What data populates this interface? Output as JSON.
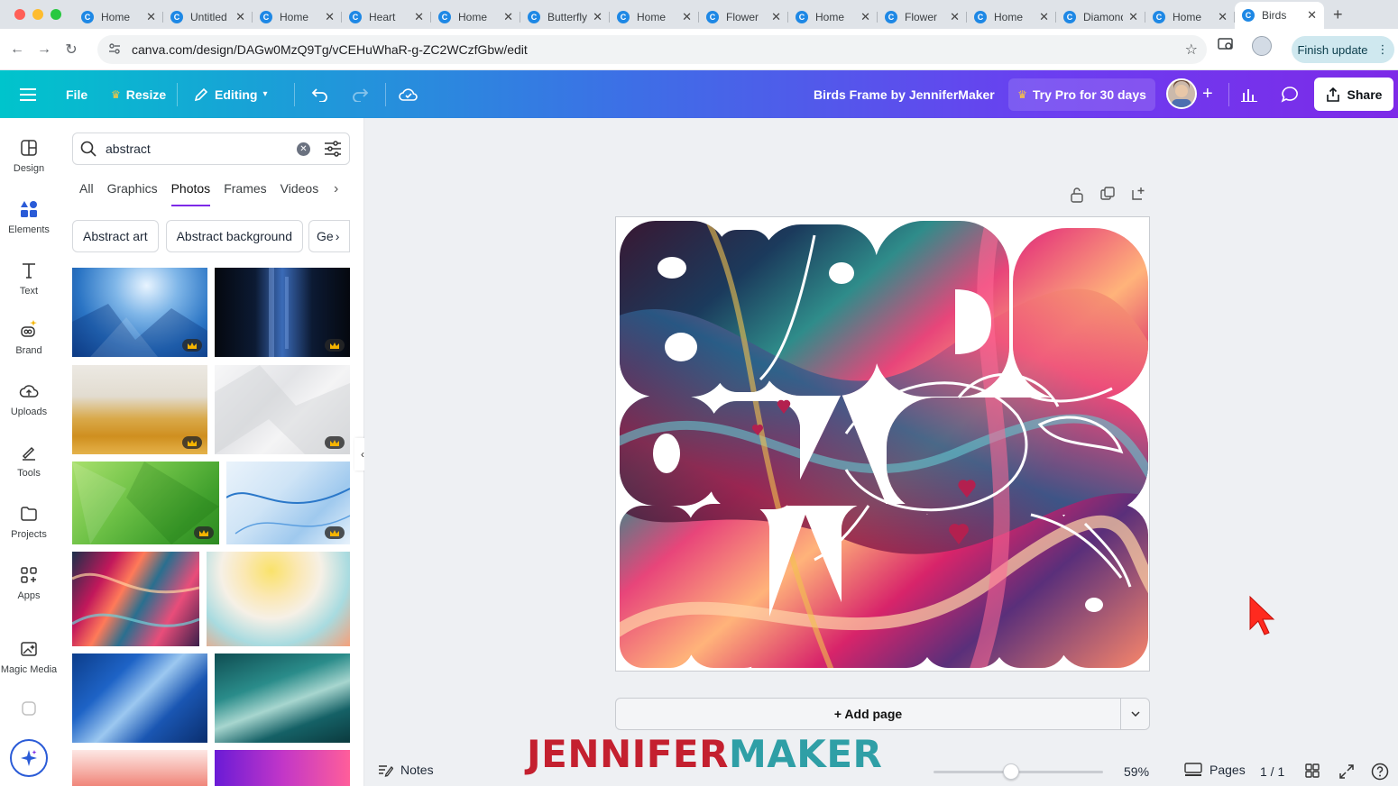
{
  "browser": {
    "tabs": [
      {
        "label": "Home"
      },
      {
        "label": "Untitled"
      },
      {
        "label": "Home"
      },
      {
        "label": "Heart"
      },
      {
        "label": "Home"
      },
      {
        "label": "Butterfly"
      },
      {
        "label": "Home"
      },
      {
        "label": "Flower"
      },
      {
        "label": "Home"
      },
      {
        "label": "Flower"
      },
      {
        "label": "Home"
      },
      {
        "label": "Diamond"
      },
      {
        "label": "Home"
      },
      {
        "label": "Birds",
        "active": true
      }
    ],
    "url": "canva.com/design/DAGw0MzQ9Tg/vCEHuWhaR-g-ZC2WCzfGbw/edit",
    "finish_update": "Finish update"
  },
  "header": {
    "file": "File",
    "resize": "Resize",
    "editing": "Editing",
    "doc_title": "Birds Frame by JenniferMaker",
    "try_pro": "Try Pro for 30 days",
    "share": "Share"
  },
  "rail": [
    {
      "label": "Design",
      "icon": "design-icon"
    },
    {
      "label": "Elements",
      "icon": "elements-icon"
    },
    {
      "label": "Text",
      "icon": "text-icon"
    },
    {
      "label": "Brand",
      "icon": "brand-icon"
    },
    {
      "label": "Uploads",
      "icon": "uploads-icon"
    },
    {
      "label": "Tools",
      "icon": "tools-icon"
    },
    {
      "label": "Projects",
      "icon": "projects-icon"
    },
    {
      "label": "Apps",
      "icon": "apps-icon"
    },
    {
      "label": "Magic Media",
      "icon": "magic-media-icon"
    }
  ],
  "panel": {
    "search_value": "abstract",
    "tabs": [
      "All",
      "Graphics",
      "Photos",
      "Frames",
      "Videos"
    ],
    "active_tab": "Photos",
    "chips": [
      "Abstract art",
      "Abstract background",
      "Ge"
    ]
  },
  "canvas": {
    "add_page": "+ Add page"
  },
  "footer": {
    "notes": "Notes",
    "watermark_a": "JENNIFER",
    "watermark_b": "MAKER",
    "zoom": "59%",
    "pages": "Pages",
    "page_count": "1 / 1"
  },
  "colors": {
    "accent": "#7d2ae8",
    "header_start": "#00c4cc",
    "header_end": "#7d2ae8",
    "watermark_red": "#c4202f",
    "watermark_teal": "#2f9fa6"
  }
}
